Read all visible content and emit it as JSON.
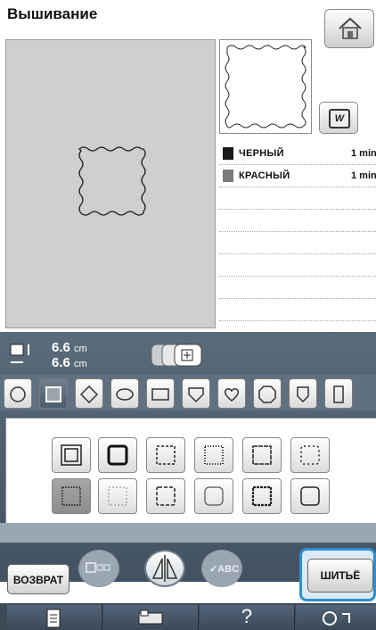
{
  "header": {
    "title": "Вышивание"
  },
  "threads": [
    {
      "name": "ЧЕРНЫЙ",
      "count": "1 min",
      "color": "#1a1a1a"
    },
    {
      "name": "КРАСНЫЙ",
      "count": "1 min",
      "color": "#7a7a7a"
    }
  ],
  "size": {
    "width": "6.6",
    "height": "6.6",
    "unit": "cm"
  },
  "shapes": [
    "circle-shape",
    "square-shape",
    "diamond-shape",
    "oval-shape",
    "rectangle-shape",
    "shield-shape",
    "heart-shape",
    "octagon-shape",
    "badge-shape",
    "tall-rect-shape"
  ],
  "buttons": {
    "back": "ВОЗВРАТ",
    "sew": "ШИТЬЁ",
    "abc": "ABC",
    "help": "?"
  }
}
